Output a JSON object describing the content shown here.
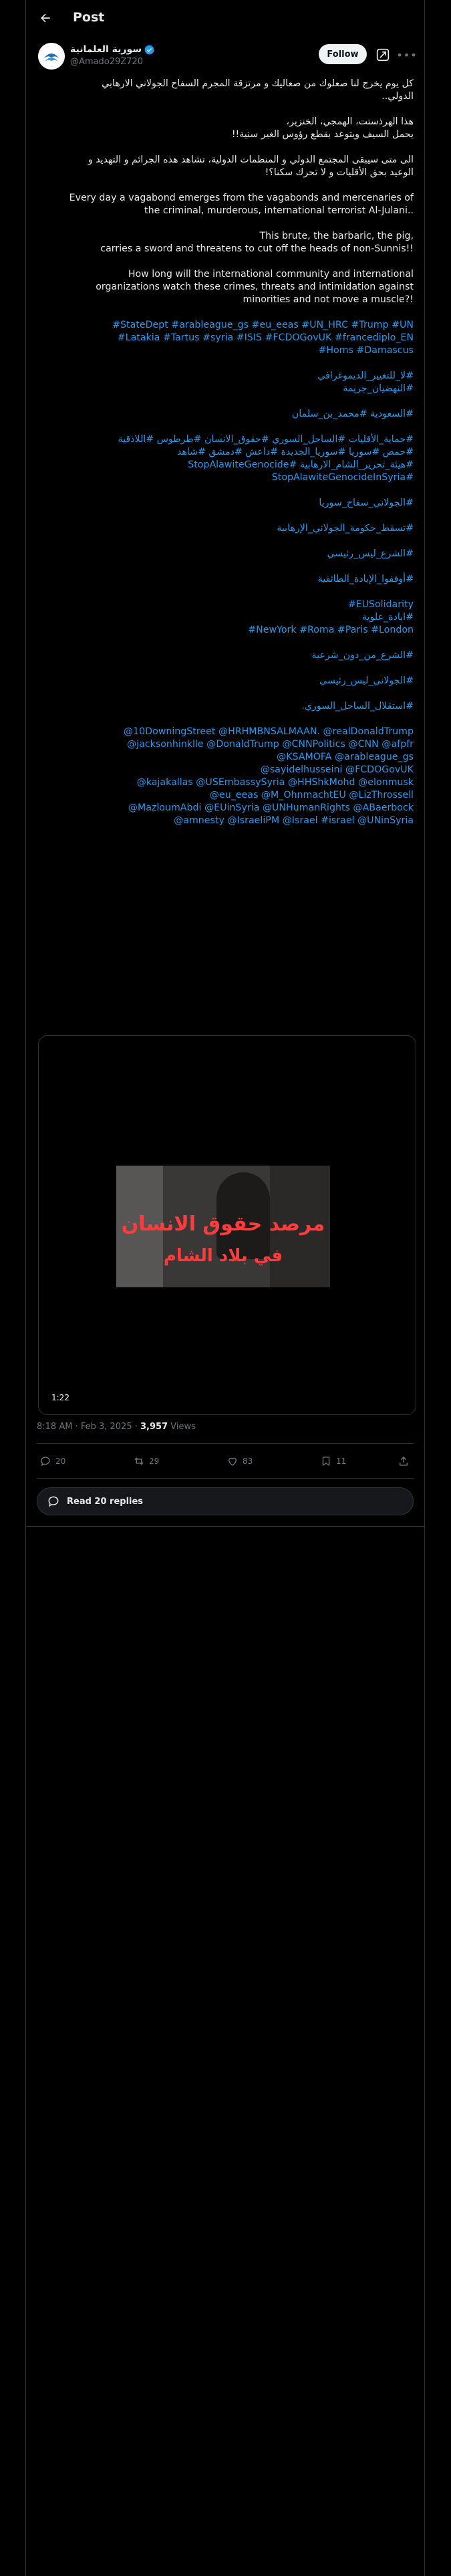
{
  "header": {
    "title": "Post"
  },
  "author": {
    "display_name": "سورية العلمانية",
    "handle": "@Amado29Z720",
    "follow_label": "Follow"
  },
  "post": {
    "ar1_l1": "كل يوم يخرج لنا صعلوك من صعاليك و مرتزقة المجرم السفاح الجولاني الارهابي",
    "ar1_l2": "الدولي..",
    "ar2_l1": "هذا الهرذستت، الهمجي، الخنزير،",
    "ar2_l2": "يحمل السيف ويتوعد بقطع رؤوس الغير سنية!!",
    "ar3_l1": "الى متى سيبقى المجتمع الدولي و المنظمات الدولية، تشاهد هذه الجرائم و التهديد و",
    "ar3_l2": "الوعيد بحق الأقليات و لا تحرك سكنا؟!",
    "en1_l1": "Every day a vagabond emerges from the vagabonds and mercenaries of",
    "en1_l2": "the criminal, murderous, international terrorist Al-Julani..",
    "en2_l1": "This brute, the barbaric, the pig,",
    "en2_l2": "carries a sword and threatens to cut off the heads of non-Sunnis!!",
    "en3_l1": "How long will the international community and international",
    "en3_l2": "organizations watch these crimes, threats and intimidation against",
    "en3_l3": "minorities and not move a muscle?!",
    "tags1_l1": "#StateDept #arableague_gs #eu_eeas #UN_HRC #Trump #UN",
    "tags1_l2": "#Latakia #Tartus #syria #ISIS #FCDOGovUK #francediplo_EN",
    "tags1_l3": "#Homs #Damascus",
    "tags2_l1": "#لا_للتغيير_الديموغرافي",
    "tags2_l2": "#النهضيان_جريمة",
    "tags3": "#السعودية #محمد_بن_سلمان",
    "tags4_l1": "#حماية_الأقليات #الساحل_السوري #حقوق_الانسان #طرطوس #اللاذقية",
    "tags4_l2": "#حمص #سوريا #سوريا_الجديدة #داعش #دمشق #شاهد",
    "tags4_l3": "#هيئة_تحرير_الشام_الارهابية #StopAlawiteGenocide",
    "tags4_l4": "#StopAlawiteGenocideInSyria",
    "tags5": "#الجولاني_سفاح_سوريا",
    "tags6": "#تسقط_حكومة_الجولاني_الإرهابية",
    "tags7": "#الشرع_ليس_رئيسي",
    "tags8": "#أوقفوا_الإبادة_الطائفية",
    "tags9_l1": "#EUSolidarity",
    "tags9_l2": "#ابادة_علوية",
    "tags9_l3": "#NewYork #Roma #Paris #London",
    "tags10": "#الشرع_من_دون_شرعية",
    "tags11": "#الجولاني_ليس_رئيسي",
    "tags12": "#استقلال_الساحل_السوري.",
    "mentions_l1": "@10DowningStreet @HRHMBNSALMAAN. @realDonaldTrump",
    "mentions_l2": "@jacksonhinklle @DonaldTrump @CNNPolitics @CNN @afpfr",
    "mentions_l3": "@KSAMOFA @arableague_gs",
    "mentions_l4": "@sayidelhusseini @FCDOGovUK",
    "mentions_l5": "@kajakallas @USEmbassySyria @HHShkMohd @elonmusk",
    "mentions_l6": "@eu_eeas @M_OhnmachtEU @LizThrossell",
    "mentions_l7": "@MazloumAbdi @EUinSyria @UNHumanRights @ABaerbock",
    "mentions_l8": "@amnesty @IsraeliPM @Israel #israel @UNinSyria"
  },
  "video": {
    "overlay_line1": "مرصد حقوق الانسان",
    "overlay_line2": "في بلاد الشام",
    "duration": "1:22"
  },
  "meta": {
    "time": "8:18 AM · Feb 3, 2025 · ",
    "views_count": "3,957",
    "views_label": " Views"
  },
  "actions": {
    "replies": "20",
    "reposts": "29",
    "likes": "83",
    "bookmarks": "11"
  },
  "read_replies": "Read 20 replies"
}
